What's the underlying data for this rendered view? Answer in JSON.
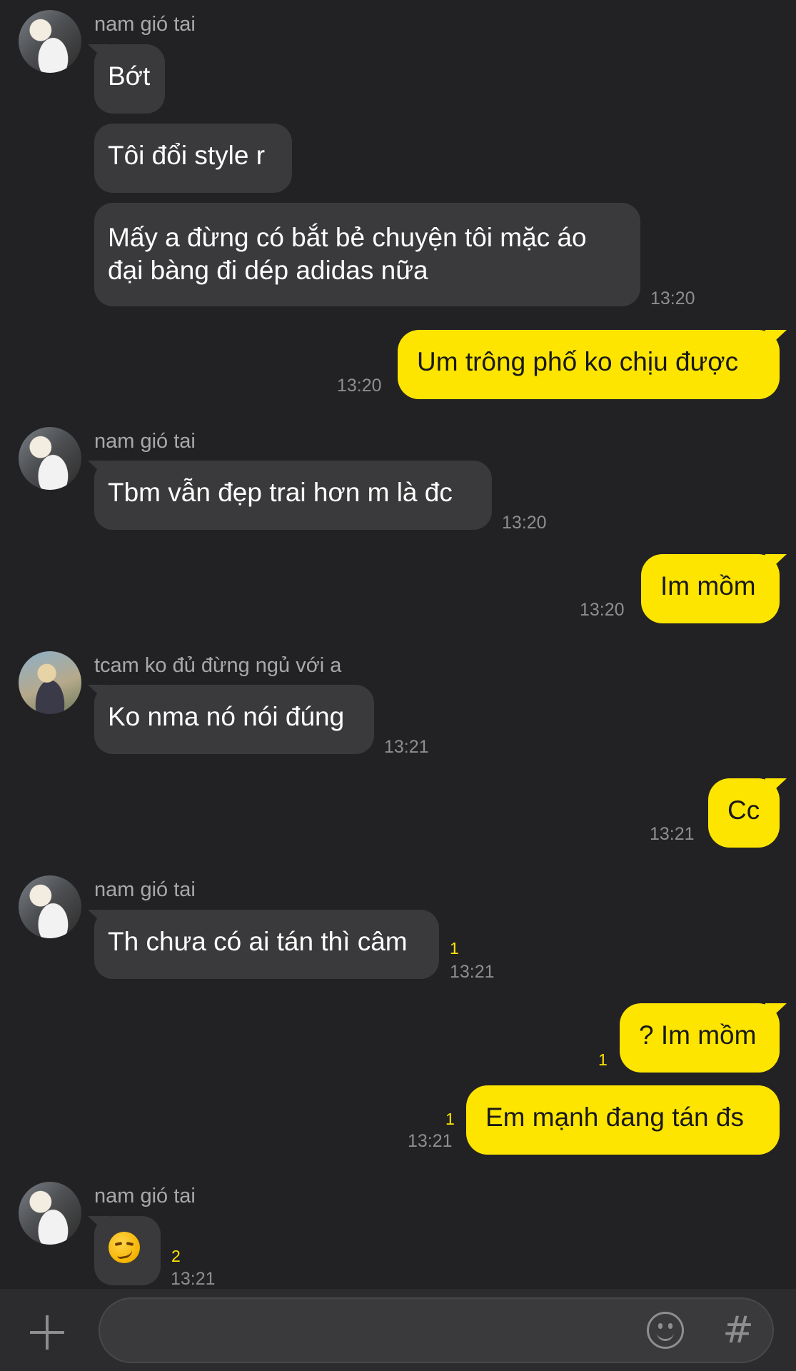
{
  "messages": [
    {
      "sender": "nam gió tai",
      "text": "Bớt"
    },
    {
      "sender": "nam gió tai",
      "text": "Tôi đổi style r"
    },
    {
      "sender": "nam gió tai",
      "text": "Mấy a đừng có bắt bẻ chuyện tôi mặc áo đại bàng đi dép adidas nữa",
      "time": "13:20"
    },
    {
      "sender": "me",
      "text": "Um trông phố ko chịu được",
      "time": "13:20"
    },
    {
      "sender": "nam gió tai",
      "text": "Tbm vẫn đẹp trai hơn m là đc",
      "time": "13:20"
    },
    {
      "sender": "me",
      "text": "Im mồm",
      "time": "13:20"
    },
    {
      "sender": "tcam ko đủ đừng ngủ với a",
      "text": "Ko nma nó nói đúng",
      "time": "13:21"
    },
    {
      "sender": "me",
      "text": "Cc",
      "time": "13:21"
    },
    {
      "sender": "nam gió tai",
      "text": "Th chưa có ai tán thì câm",
      "time": "13:21",
      "unread": "1"
    },
    {
      "sender": "me",
      "text": "? Im mồm",
      "unread": "1"
    },
    {
      "sender": "me",
      "text": "Em mạnh đang tán đs",
      "time": "13:21",
      "unread": "1"
    },
    {
      "sender": "nam gió tai",
      "emoji": "smirking-face",
      "time": "13:21",
      "unread": "2"
    }
  ],
  "composer": {
    "plus_icon": "plus-icon",
    "emoji_icon": "smiley-icon",
    "hash_label": "#"
  },
  "colors": {
    "background": "#222224",
    "incoming_bubble": "#3a3a3c",
    "outgoing_bubble": "#fee500",
    "unread": "#fee500"
  }
}
